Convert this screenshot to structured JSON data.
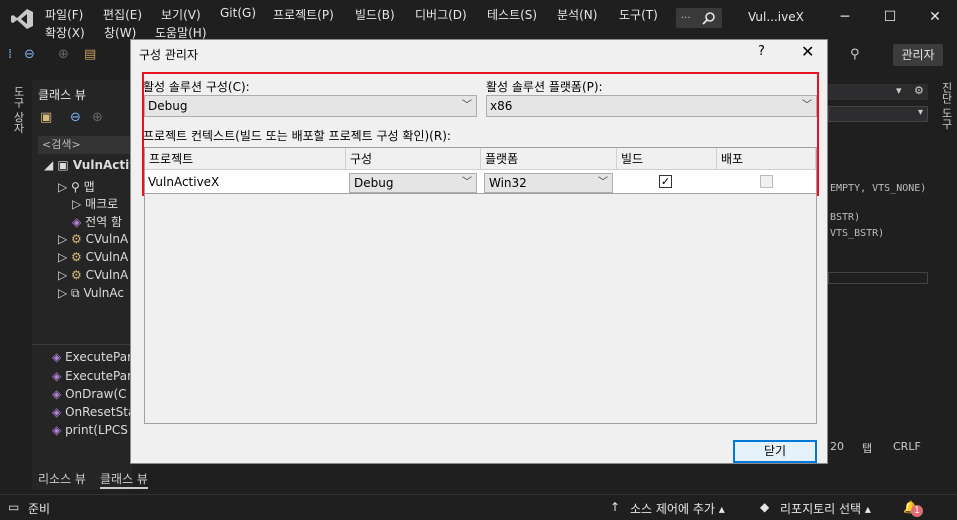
{
  "menu": {
    "row1": [
      "파일(F)",
      "편집(E)",
      "보기(V)",
      "Git(G)",
      "프로젝트(P)",
      "빌드(B)",
      "디버그(D)",
      "테스트(S)",
      "분석(N)",
      "도구(T)"
    ],
    "row2": [
      "확장(X)",
      "창(W)",
      "도움말(H)"
    ]
  },
  "window": {
    "title": "Vul...iveX",
    "search_dots": "...",
    "admin_label": "관리자"
  },
  "left_rail": {
    "label": "도구 상자"
  },
  "right_rail": {
    "label": "진단 도구"
  },
  "class_view": {
    "title": "클래스 뷰",
    "search_placeholder": "<검색>",
    "tree": [
      "VulnActive",
      "맵",
      "매크로",
      "전역 함",
      "CVulnA",
      "CVulnA",
      "CVulnA",
      "VulnAc"
    ],
    "members": [
      "ExecutePar",
      "ExecutePar",
      "OnDraw(C",
      "OnResetSta",
      "print(LPCS"
    ]
  },
  "bottom_tabs": [
    "리소스 뷰",
    "클래스 뷰"
  ],
  "code_lines": [
    "EMPTY, VTS_NONE)",
    "BSTR)",
    "VTS_BSTR)"
  ],
  "status": {
    "ready": "준비",
    "source_control": "소스 제어에 추가",
    "repo": "리포지토리 선택",
    "notif_count": "1",
    "pos": "20",
    "tab": "탭",
    "eol": "CRLF"
  },
  "dialog": {
    "title": "구성 관리자",
    "help": "?",
    "active_config_label": "활성 솔루션 구성(C):",
    "active_config_value": "Debug",
    "active_platform_label": "활성 솔루션 플랫폼(P):",
    "active_platform_value": "x86",
    "contexts_label": "프로젝트 컨텍스트(빌드 또는 배포할 프로젝트 구성 확인)(R):",
    "columns": [
      "프로젝트",
      "구성",
      "플랫폼",
      "빌드",
      "배포"
    ],
    "rows": [
      {
        "project": "VulnActiveX",
        "config": "Debug",
        "platform": "Win32",
        "build": true,
        "deploy": false
      }
    ],
    "close_label": "닫기"
  },
  "colors": {
    "highlight_frame": "#e81123",
    "accent": "#0078d7"
  }
}
